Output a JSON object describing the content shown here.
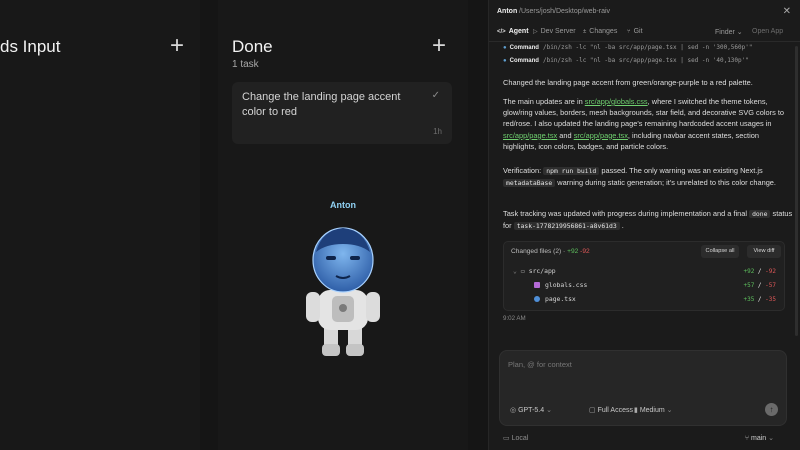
{
  "board": {
    "column1": {
      "title": "ds Input",
      "add_label": "+"
    },
    "column2": {
      "title": "Done",
      "subtitle": "1 task",
      "add_label": "+"
    },
    "card": {
      "text": "Change the landing page accent color to red",
      "check": "✓",
      "time": "1h"
    },
    "character": {
      "name": "Anton"
    }
  },
  "panel": {
    "app": "Anton",
    "path": "/Users/josh/Desktop/web-raiv",
    "close": "✕",
    "tabs": [
      {
        "label": "Agent",
        "icon": "</>"
      },
      {
        "label": "Dev Server",
        "icon": "▷"
      },
      {
        "label": "Changes",
        "icon": "±"
      },
      {
        "label": "Git",
        "icon": "⑂"
      }
    ],
    "finder": "Finder ⌄",
    "open_app": "Open App",
    "commands": [
      {
        "label": "Command",
        "arg": "/bin/zsh -lc \"nl -ba src/app/page.tsx | sed -n '300,560p'\""
      },
      {
        "label": "Command",
        "arg": "/bin/zsh -lc \"nl -ba src/app/page.tsx | sed -n '40,130p'\""
      }
    ],
    "msg1": "Changed the landing page accent from green/orange-purple to a red palette.",
    "msg2": {
      "a": "The main updates are in ",
      "link1": "src/app/globals.css",
      "b": ", where I switched the theme tokens, glow/ring values, borders, mesh backgrounds, star field, and decorative SVG colors to red/rose. I also updated the landing page's remaining hardcoded accent usages in ",
      "link2": "src/app/page.tsx",
      "c": " and ",
      "link3": "src/app/page.tsx",
      "d": ", including navbar accent states, section highlights, icon colors, badges, and particle colors."
    },
    "msg3": {
      "a": "Verification: ",
      "code1": "npm run build",
      "b": " passed. The only warning was an existing Next.js ",
      "code2": "metadataBase",
      "c": " warning during static generation; it's unrelated to this color change."
    },
    "msg4": {
      "a": "Task tracking was updated with progress during implementation and a final ",
      "code1": "done",
      "b": " status for ",
      "code2": "task-1778219956861-a8v61d3",
      "c": " ."
    },
    "files": {
      "head": "Changed files (2)",
      "head_add": "+92",
      "head_del": "-92",
      "collapse": "Collapse all",
      "view": "View diff",
      "rows": [
        {
          "name": "src/app",
          "add": "+92",
          "del": "-92"
        },
        {
          "name": "globals.css",
          "add": "+57",
          "del": "-57"
        },
        {
          "name": "page.tsx",
          "add": "+35",
          "del": "-35"
        }
      ]
    },
    "timestamp": "9:02 AM",
    "composer": {
      "placeholder": "Plan, @ for context",
      "model": "GPT-5.4",
      "access": "Full Access",
      "effort": "Medium",
      "send": "↑"
    },
    "footer": {
      "local": "Local",
      "branch": "main"
    }
  },
  "colors": {
    "accent_link": "#6fd06f",
    "add": "#5ec05e",
    "del": "#e05858",
    "character_label": "#8fd0f2"
  }
}
